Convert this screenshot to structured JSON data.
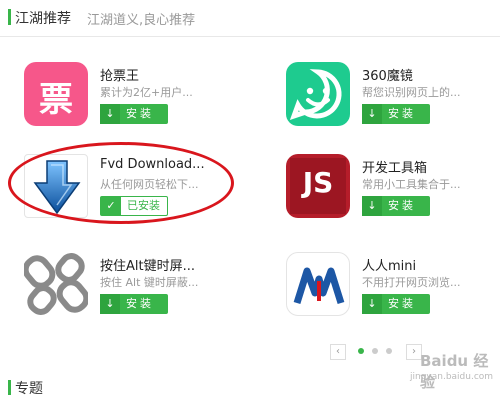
{
  "header": {
    "title": "江湖推荐",
    "subtitle": "江湖道义,良心推荐"
  },
  "apps": [
    {
      "name": "抢票王",
      "desc": "累计为2亿+用户...",
      "button": "安装"
    },
    {
      "name": "360魔镜",
      "desc": "帮您识别网页上的...",
      "button": "安装"
    },
    {
      "name": "Fvd Download...",
      "desc": "从任何网页轻松下...",
      "button": "已安装"
    },
    {
      "name": "开发工具箱",
      "desc": "常用小工具集合于...",
      "button": "安装"
    },
    {
      "name": "按住Alt键时屏...",
      "desc": "按住 Alt 键时屏蔽...",
      "button": "安装"
    },
    {
      "name": "人人mini",
      "desc": "不用打开网页浏览...",
      "button": "安装"
    }
  ],
  "icons": {
    "ticket_glyph": "票",
    "devtools_glyph": "JS",
    "renren_glyph": "人人"
  },
  "pager": {
    "prev": "‹",
    "next": "›",
    "pages": 3,
    "active_page": 1
  },
  "footer": {
    "title": "专题"
  },
  "watermark": {
    "text": "Baidu 经验",
    "url": "jingyan.baidu.com"
  },
  "colors": {
    "accent": "#39b54a",
    "highlight": "#d9161d"
  }
}
